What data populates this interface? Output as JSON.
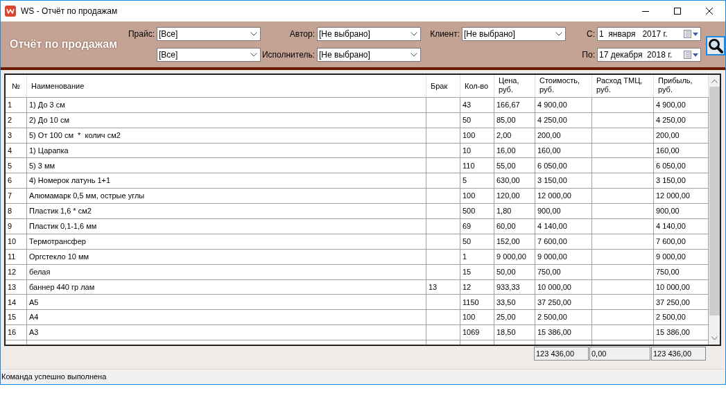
{
  "window": {
    "title": "WS - Отчёт по продажам"
  },
  "header": {
    "title": "Отчёт по продажам"
  },
  "filter_groups": [
    {
      "kind": "select",
      "fields": [
        {
          "label": "Прайс:",
          "value": "[Все]"
        },
        {
          "value": "[Все]"
        }
      ]
    },
    {
      "kind": "select",
      "fields": [
        {
          "label": "Автор:",
          "value": "[Не выбрано]"
        },
        {
          "label": "Исполнитель:",
          "value": "[Не выбрано]"
        }
      ]
    },
    {
      "kind": "select",
      "fields": [
        {
          "label": "Клиент:",
          "value": "[Не выбрано]"
        }
      ]
    },
    {
      "kind": "date",
      "fields": [
        {
          "label": "С:",
          "value": "1  января   2017 г."
        },
        {
          "label": "По:",
          "value": "17 декабря  2018 г."
        }
      ]
    }
  ],
  "table": {
    "columns": [
      "№",
      "Наименование",
      "Брак",
      "Кол-во",
      "Цена, руб.",
      "Стоимость, руб.",
      "Расход ТМЦ, руб.",
      "Прибыль, руб."
    ],
    "rows": [
      {
        "no": "1",
        "name": "1) До 3 см",
        "qty": "43",
        "price": "166,67",
        "cost": "4 900,00",
        "profit": "4 900,00"
      },
      {
        "no": "2",
        "name": "2) До 10 см",
        "qty": "50",
        "price": "85,00",
        "cost": "4 250,00",
        "profit": "4 250,00"
      },
      {
        "no": "3",
        "name": "5) От 100 см  *  колич см2",
        "qty": "100",
        "price": "2,00",
        "cost": "200,00",
        "profit": "200,00"
      },
      {
        "no": "4",
        "name": "1) Царапка",
        "qty": "10",
        "price": "16,00",
        "cost": "160,00",
        "profit": "160,00"
      },
      {
        "no": "5",
        "name": "5) 3 мм",
        "qty": "110",
        "price": "55,00",
        "cost": "6 050,00",
        "profit": "6 050,00"
      },
      {
        "no": "6",
        "name": "4) Номерок латунь 1+1",
        "qty": "5",
        "price": "630,00",
        "cost": "3 150,00",
        "profit": "3 150,00"
      },
      {
        "no": "7",
        "name": "Алюмамарк 0,5 мм, острые углы",
        "qty": "100",
        "price": "120,00",
        "cost": "12 000,00",
        "profit": "12 000,00"
      },
      {
        "no": "8",
        "name": "Пластик 1,6 * см2",
        "qty": "500",
        "price": "1,80",
        "cost": "900,00",
        "profit": "900,00"
      },
      {
        "no": "9",
        "name": "Пластик 0,1-1,6 мм",
        "qty": "69",
        "price": "60,00",
        "cost": "4 140,00",
        "profit": "4 140,00"
      },
      {
        "no": "10",
        "name": "Термотрансфер",
        "qty": "50",
        "price": "152,00",
        "cost": "7 600,00",
        "profit": "7 600,00"
      },
      {
        "no": "11",
        "name": "Оргстекло 10 мм",
        "qty": "1",
        "price": "9 000,00",
        "cost": "9 000,00",
        "profit": "9 000,00"
      },
      {
        "no": "12",
        "name": "белая",
        "qty": "15",
        "price": "50,00",
        "cost": "750,00",
        "profit": "750,00"
      },
      {
        "no": "13",
        "name": "баннер 440 гр лам",
        "brak": "13",
        "qty": "12",
        "price": "933,33",
        "cost": "10 000,00",
        "profit": "10 000,00"
      },
      {
        "no": "14",
        "name": "А5",
        "qty": "1150",
        "price": "33,50",
        "cost": "37 250,00",
        "profit": "37 250,00"
      },
      {
        "no": "15",
        "name": "А4",
        "qty": "100",
        "price": "25,00",
        "cost": "2 500,00",
        "profit": "2 500,00"
      },
      {
        "no": "16",
        "name": "А3",
        "qty": "1069",
        "price": "18,50",
        "cost": "15 386,00",
        "profit": "15 386,00"
      }
    ],
    "totals": {
      "cost": "123 436,00",
      "tmc": "0,00",
      "profit": "123 436,00"
    }
  },
  "status_bar": {
    "text": "Команда успешно выполнена"
  }
}
